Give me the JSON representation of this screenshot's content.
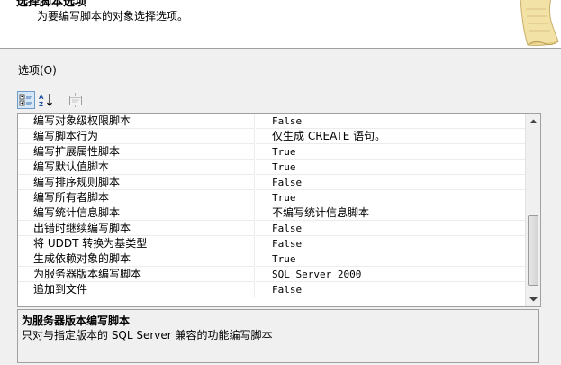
{
  "header": {
    "title": "选择脚本选项",
    "subtitle": "为要编写脚本的对象选择选项。"
  },
  "options_label": "选项(O)",
  "toolbar": {
    "categorized_icon": "categorized-icon",
    "alphabetical_icon": "alphabetical-sort-icon",
    "property_pages_icon": "property-pages-icon"
  },
  "grid": {
    "rows": [
      {
        "name": "编写对象级权限脚本",
        "value": "False"
      },
      {
        "name": "编写脚本行为",
        "value": "仅生成 CREATE 语句。"
      },
      {
        "name": "编写扩展属性脚本",
        "value": "True"
      },
      {
        "name": "编写默认值脚本",
        "value": "True"
      },
      {
        "name": "编写排序规则脚本",
        "value": "False"
      },
      {
        "name": "编写所有者脚本",
        "value": "True"
      },
      {
        "name": "编写统计信息脚本",
        "value": "不编写统计信息脚本"
      },
      {
        "name": "出错时继续编写脚本",
        "value": "False"
      },
      {
        "name": "将 UDDT 转换为基类型",
        "value": "False"
      },
      {
        "name": "生成依赖对象的脚本",
        "value": "True"
      },
      {
        "name": "为服务器版本编写脚本",
        "value": "SQL Server 2000"
      },
      {
        "name": "追加到文件",
        "value": "False"
      }
    ]
  },
  "description": {
    "title": "为服务器版本编写脚本",
    "text": "只对与指定版本的 SQL Server 兼容的功能编写脚本"
  },
  "colors": {
    "window_bg": "#f0f0f0",
    "header_bg": "#ffffff",
    "border": "#a0a0a0",
    "toolbar_active": "#d6e8f8"
  }
}
